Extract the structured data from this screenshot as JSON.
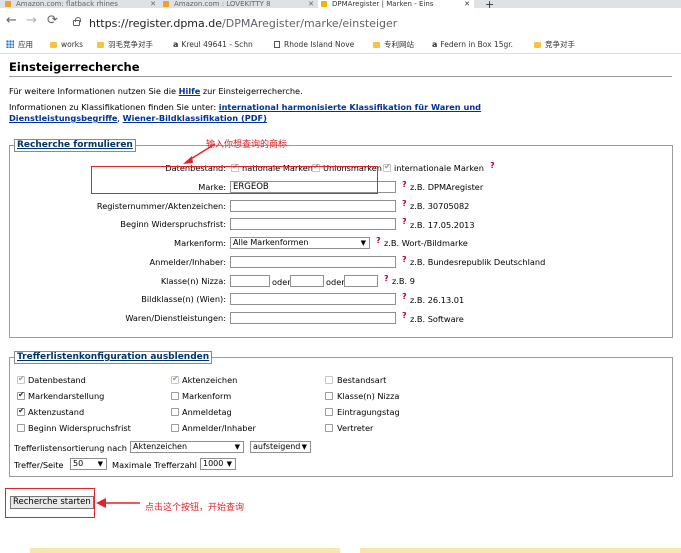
{
  "browser": {
    "tabs": [
      {
        "label": "Amazon.com: flatback rhines"
      },
      {
        "label": "Amazon.com : LOVEKITTY 8"
      },
      {
        "label": "DPMAregister | Marken - Eins"
      }
    ],
    "url_domain": "https://register.dpma.de",
    "url_path": "/DPMAregister/marke/einsteiger",
    "bookmarks": [
      {
        "label": "应用"
      },
      {
        "label": "works"
      },
      {
        "label": "羽毛竞争对手"
      },
      {
        "label": "Kreul 49641 - Schn"
      },
      {
        "label": "Rhode Island Nove"
      },
      {
        "label": "专利网站"
      },
      {
        "label": "Federn in Box 15gr."
      },
      {
        "label": "竞争对手"
      }
    ]
  },
  "page": {
    "title": "Einsteigerrecherche",
    "intro": {
      "prefix": "Für weitere Informationen nutzen Sie die ",
      "help_link": "Hilfe",
      "suffix": " zur Einsteigerrecherche."
    },
    "classif": {
      "prefix": "Informationen zu Klassifikationen finden Sie unter: ",
      "link1_a": "international harmonisierte Klassifikation für Waren und",
      "link1_b": "Dienstleistungsbegriffe",
      "sep": ", ",
      "link2": "Wiener-Bildklassifikation (PDF)"
    }
  },
  "search_form": {
    "legend": "Recherche formulieren",
    "datenbestand": {
      "label": "Datenbestand:",
      "options": [
        "nationale Marken",
        "Unionsmarken",
        "internationale Marken"
      ]
    },
    "fields": [
      {
        "label": "Marke:",
        "value": "ERGEOB",
        "example": "z.B. DPMAregister"
      },
      {
        "label": "Registernummer/Aktenzeichen:",
        "value": "",
        "example": "z.B. 30705082"
      },
      {
        "label": "Beginn Widerspruchsfrist:",
        "value": "",
        "example": "z.B. 17.05.2013"
      },
      {
        "label": "Markenform:",
        "value": "Alle Markenformen",
        "example": "z.B. Wort-/Bildmarke"
      },
      {
        "label": "Anmelder/Inhaber:",
        "value": "",
        "example": "z.B. Bundesrepublik Deutschland"
      },
      {
        "label": "Klasse(n) Nizza:",
        "value": "",
        "example": "z.B. 9"
      },
      {
        "label": "Bildklasse(n) (Wien):",
        "value": "",
        "example": "z.B. 26.13.01"
      },
      {
        "label": "Waren/Dienstleistungen:",
        "value": "",
        "example": "z.B. Software"
      }
    ],
    "oder": "oder",
    "help_mark": "?"
  },
  "result_config": {
    "legend": "Trefferlistenkonfiguration ausblenden",
    "checkboxes": [
      {
        "label": "Datenbestand",
        "checked": true,
        "disabled": true
      },
      {
        "label": "Aktenzeichen",
        "checked": true,
        "disabled": true
      },
      {
        "label": "Bestandsart",
        "checked": false,
        "disabled": true
      },
      {
        "label": "Markendarstellung",
        "checked": true,
        "disabled": false
      },
      {
        "label": "Markenform",
        "checked": false,
        "disabled": false
      },
      {
        "label": "Klasse(n) Nizza",
        "checked": false,
        "disabled": false
      },
      {
        "label": "Aktenzustand",
        "checked": true,
        "disabled": false
      },
      {
        "label": "Anmeldetag",
        "checked": false,
        "disabled": false
      },
      {
        "label": "Eintragungstag",
        "checked": false,
        "disabled": false
      },
      {
        "label": "Beginn Widerspruchsfrist",
        "checked": false,
        "disabled": false
      },
      {
        "label": "Anmelder/Inhaber",
        "checked": false,
        "disabled": false
      },
      {
        "label": "Vertreter",
        "checked": false,
        "disabled": false
      }
    ],
    "sort_label": "Trefferlistensortierung nach",
    "sort_value": "Aktenzeichen",
    "order_value": "aufsteigend",
    "per_page_label": "Treffer/Seite",
    "per_page_value": "50",
    "max_label": "Maximale Trefferzahl",
    "max_value": "1000"
  },
  "start_button": "Recherche starten",
  "annotations": {
    "top": "输入你想查询的商标",
    "bottom": "点击这个按钮，开始查询"
  },
  "colors": {
    "annotation_red": "#e0252a",
    "link_blue": "#003399",
    "legend_blue": "#00336a"
  }
}
